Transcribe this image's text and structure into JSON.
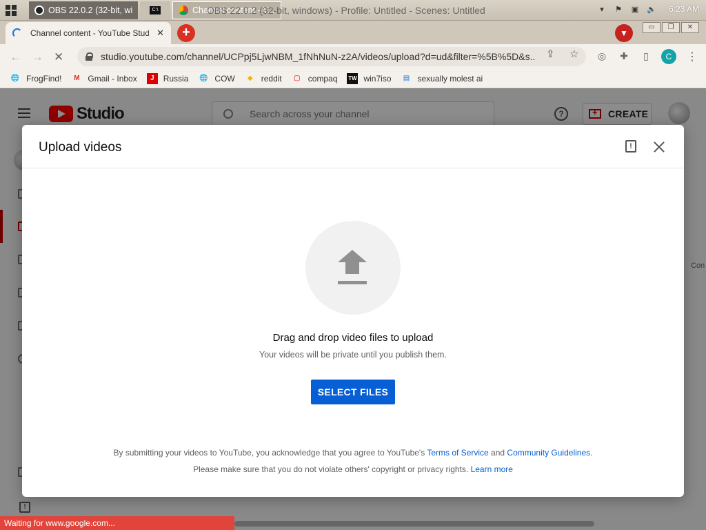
{
  "os": {
    "tasks": [
      {
        "label": "OBS 22.0.2 (32-bit, wi..."
      },
      {
        "label": "C:\\"
      },
      {
        "label": "Channel content - Y..."
      }
    ],
    "obs_title": "OBS 22.0.2 (32-bit, windows) - Profile: Untitled - Scenes: Untitled",
    "clock": "6:23 AM"
  },
  "browser": {
    "tab_title": "Channel content - YouTube Studio",
    "url": "studio.youtube.com/channel/UCPpj5LjwNBM_1fNhNuN-z2A/videos/upload?d=ud&filter=%5B%5D&s...",
    "profile_initial": "C",
    "bookmarks": [
      {
        "label": "FrogFind!",
        "icon": "globe-icon"
      },
      {
        "label": "Gmail - Inbox",
        "icon": "gmail-icon"
      },
      {
        "label": "Russia",
        "icon": "red-square-icon"
      },
      {
        "label": "COW",
        "icon": "globe-icon"
      },
      {
        "label": "reddit",
        "icon": "reddit-icon"
      },
      {
        "label": "compaq",
        "icon": "chat-icon"
      },
      {
        "label": "win7iso",
        "icon": "tw-icon"
      },
      {
        "label": "sexually molest ai",
        "icon": "doc-icon"
      }
    ],
    "status": "Waiting for www.google.com..."
  },
  "studio": {
    "logo_text": "Studio",
    "search_placeholder": "Search across your channel",
    "create_label": "CREATE",
    "right_label": "Con"
  },
  "modal": {
    "title": "Upload videos",
    "drop_title": "Drag and drop video files to upload",
    "drop_sub": "Your videos will be private until you publish them.",
    "select_label": "SELECT FILES",
    "legal1_pre": "By submitting your videos to YouTube, you acknowledge that you agree to YouTube's ",
    "legal1_tos": "Terms of Service",
    "legal1_and": " and ",
    "legal1_cg": "Community Guidelines",
    "legal1_end": ".",
    "legal2_pre": "Please make sure that you do not violate others' copyright or privacy rights. ",
    "legal2_link": "Learn more"
  },
  "colors": {
    "accent": "#065fd4",
    "youtube_red": "#ff0000",
    "status_bar": "#e0443a"
  }
}
